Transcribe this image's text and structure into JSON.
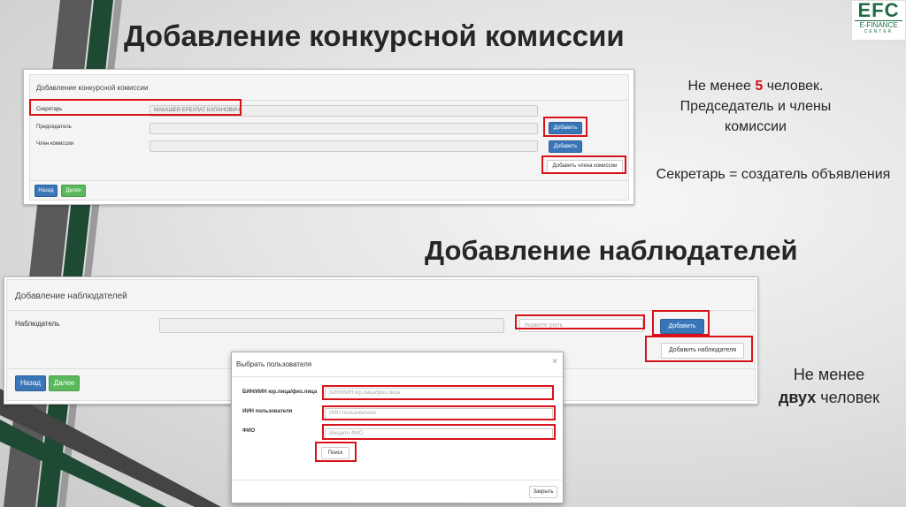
{
  "logo": {
    "big": "EFC",
    "small": "E-FINANCE",
    "tiny": "CENTER"
  },
  "headings": {
    "commission": "Добавление конкурсной комиссии",
    "observers": "Добавление наблюдателей"
  },
  "notes": {
    "min_prefix": "Не менее ",
    "min_count": "5",
    "min_suffix": " человек.",
    "line2": "Председатель и члены",
    "line3": "комиссии",
    "secretary": "Секретарь = создатель объявления",
    "observers_line1": "Не менее",
    "observers_bold": "двух",
    "observers_suffix": " человек"
  },
  "commission_form": {
    "title": "Добавление конкурсной комиссии",
    "secretary_label": "Секретарь",
    "secretary_value": "МАКАШЕВ ЕРБУЛАТ КАПАНОВИЧ",
    "chairman_label": "Председатель",
    "chairman_value": "",
    "member_label": "Член комиссии",
    "member_value": "",
    "add_label": "Добавить",
    "add_member_label": "Добавить члена комиссии",
    "back_label": "Назад",
    "next_label": "Далее"
  },
  "observers_form": {
    "title": "Добавление наблюдателей",
    "observer_label": "Наблюдатель",
    "observer_value": "",
    "role_placeholder": "Укажите роль",
    "add_label": "Добавить",
    "add_observer_label": "Добавить наблюдателя",
    "back_label": "Назад",
    "next_label": "Далее"
  },
  "modal": {
    "title": "Выбрать пользователя",
    "close_glyph": "×",
    "bin_label": "БИН/ИИН юр.лица/физ.лица",
    "bin_placeholder": "БИН/ИИН юр.лица/физ.лица",
    "iin_label": "ИИН пользователя",
    "iin_placeholder": "ИИН пользователя",
    "fio_label": "ФИО",
    "fio_placeholder": "Введите ФИО",
    "search_label": "Поиск",
    "close_label": "Закрыть"
  }
}
